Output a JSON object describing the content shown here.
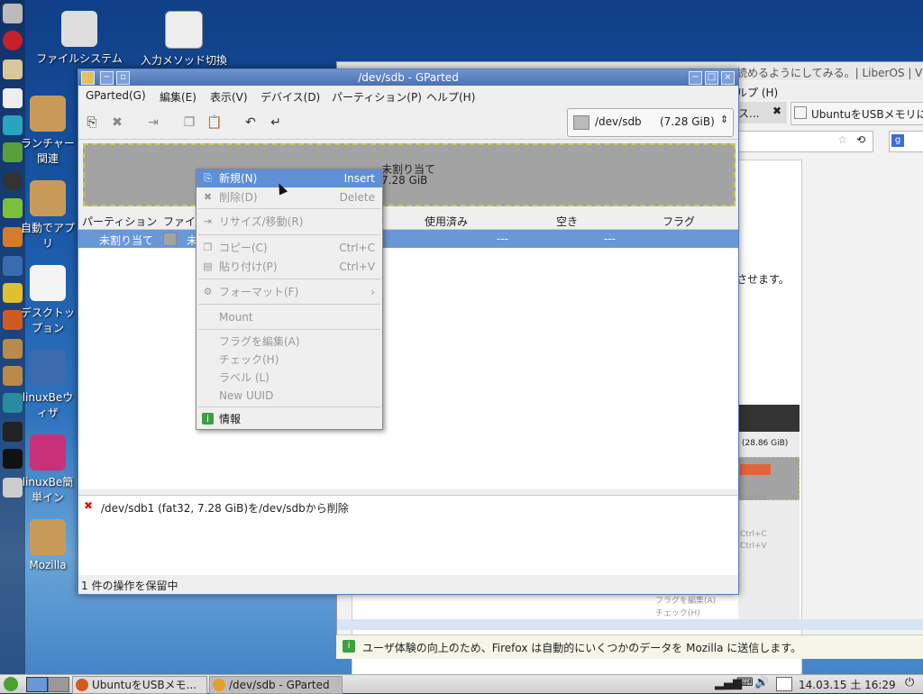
{
  "desktop": {
    "icons": [
      {
        "label": "ファイルシステム"
      },
      {
        "label": "入力メソッド切換"
      },
      {
        "label": "ランチャー関連"
      },
      {
        "label": "自動でアプリ"
      },
      {
        "label": "デスクトップョン"
      },
      {
        "label": "linuxBeウィザ"
      },
      {
        "label": "linuxBe簡単イン"
      },
      {
        "label": "Mozilla"
      }
    ]
  },
  "firefox": {
    "title_fragment": "読めるようにしてみる。| LiberOS | Viv",
    "menu_help": "ルプ (H)",
    "tab_label": "UbuntuをUSBメモリに",
    "tab_prev": "ス...",
    "body_text": "させます。",
    "inner_devsel": "(28.86 GiB)",
    "inner_menu": [
      "Delete",
      "Ctrl+C",
      "Ctrl+V",
      "フラグを編集(A)",
      "チェック(H)"
    ],
    "notification": "ユーザ体験の向上のため、Firefox は自動的にいくつかのデータを Mozilla に送信します。"
  },
  "gparted": {
    "title": "/dev/sdb - GParted",
    "menu": [
      "GParted(G)",
      "編集(E)",
      "表示(V)",
      "デバイス(D)",
      "パーティション(P)",
      "ヘルプ(H)"
    ],
    "device_path": "/dev/sdb",
    "device_size": "(7.28 GiB)",
    "graph_label": "未割り当て",
    "graph_size": "7.28 GiB",
    "columns": [
      "パーティション",
      "ファイル",
      "使用済み",
      "空き",
      "フラグ"
    ],
    "row": {
      "partition": "未割り当て",
      "fs": "未",
      "used": "---",
      "free": "---"
    },
    "oplog": "/dev/sdb1 (fat32, 7.28 GiB)を/dev/sdbから削除",
    "status": "1 件の操作を保留中"
  },
  "context_menu": {
    "items": [
      {
        "label": "新規(N)",
        "accel": "Insert",
        "state": "active"
      },
      {
        "label": "削除(D)",
        "accel": "Delete",
        "state": "disabled"
      },
      {
        "label": "リサイズ/移動(R)",
        "accel": "",
        "state": "disabled"
      },
      {
        "label": "コピー(C)",
        "accel": "Ctrl+C",
        "state": "disabled"
      },
      {
        "label": "貼り付け(P)",
        "accel": "Ctrl+V",
        "state": "disabled"
      },
      {
        "label": "フォーマット(F)",
        "accel": "›",
        "state": "disabled"
      },
      {
        "label": "Mount",
        "accel": "",
        "state": "disabled"
      },
      {
        "label": "フラグを編集(A)",
        "accel": "",
        "state": "disabled"
      },
      {
        "label": "チェック(H)",
        "accel": "",
        "state": "disabled"
      },
      {
        "label": "ラベル (L)",
        "accel": "",
        "state": "disabled"
      },
      {
        "label": "New UUID",
        "accel": "",
        "state": "disabled"
      },
      {
        "label": "情報",
        "accel": "",
        "state": "enabled"
      }
    ]
  },
  "taskbar": {
    "tasks": [
      "UbuntuをUSBメモ...",
      "/dev/sdb - GParted"
    ],
    "clock": "14.03.15 土 16:29"
  },
  "colors": {
    "accent": "#5f8fd6",
    "title_bar": "#4a72b4"
  }
}
